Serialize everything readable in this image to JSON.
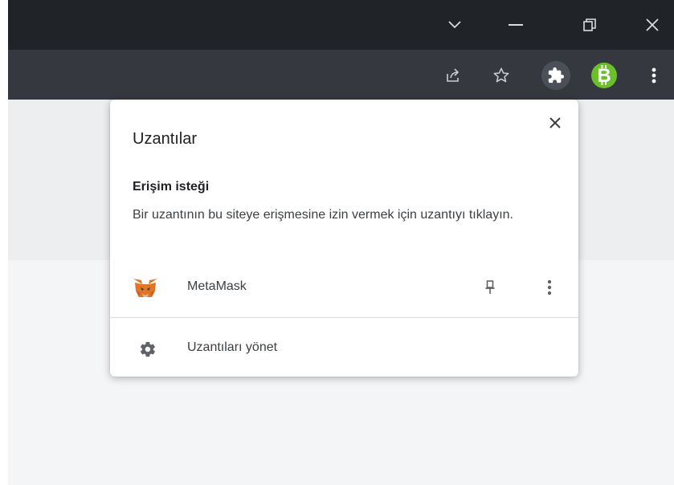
{
  "window_controls": {
    "icons": [
      "chevron-down-icon",
      "minimize-icon",
      "restore-icon",
      "close-icon"
    ]
  },
  "toolbar": {
    "icons": [
      "share-icon",
      "star-icon",
      "puzzle-icon",
      "bitcoin-icon",
      "more-vert-icon"
    ],
    "colors": {
      "titlebar": "#202327",
      "toolbar": "#35393f",
      "bitcoin": "#6bbf2a"
    }
  },
  "popup": {
    "title": "Uzantılar",
    "access_heading": "Erişim isteği",
    "access_description": "Bir uzantının bu siteye erişmesine izin vermek için uzantıyı tıklayın.",
    "extensions": [
      {
        "name": "MetaMask",
        "icon": "metamask-fox-icon"
      }
    ],
    "manage_label": "Uzantıları yönet"
  }
}
